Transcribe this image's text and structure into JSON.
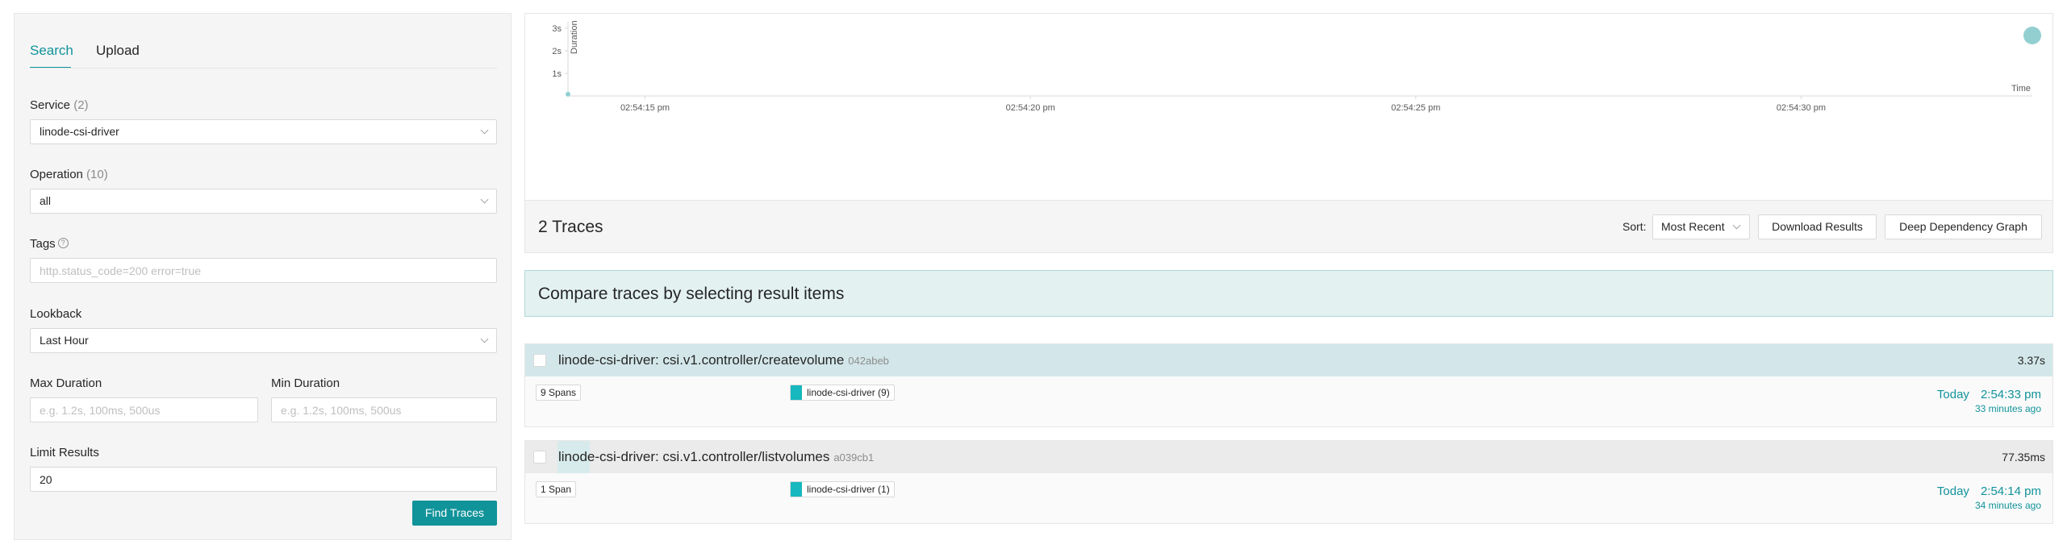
{
  "search_panel": {
    "tabs": [
      {
        "label": "Search",
        "active": true
      },
      {
        "label": "Upload",
        "active": false
      }
    ],
    "service": {
      "label": "Service",
      "count": "(2)",
      "value": "linode-csi-driver"
    },
    "operation": {
      "label": "Operation",
      "count": "(10)",
      "value": "all"
    },
    "tags": {
      "label": "Tags",
      "help_icon": "question-circle-icon",
      "value": "",
      "placeholder": "http.status_code=200 error=true"
    },
    "lookback": {
      "label": "Lookback",
      "value": "Last Hour"
    },
    "max_duration": {
      "label": "Max Duration",
      "value": "",
      "placeholder": "e.g. 1.2s, 100ms, 500us"
    },
    "min_duration": {
      "label": "Min Duration",
      "value": "",
      "placeholder": "e.g. 1.2s, 100ms, 500us"
    },
    "limit_results": {
      "label": "Limit Results",
      "value": "20"
    },
    "find_button": "Find Traces"
  },
  "chart_data": {
    "type": "scatter",
    "title": "",
    "xlabel": "Time",
    "ylabel": "Duration",
    "y_ticks": [
      "1s",
      "2s",
      "3s"
    ],
    "ylim": [
      0,
      3.37
    ],
    "x_ticks": [
      "02:54:15 pm",
      "02:54:20 pm",
      "02:54:25 pm",
      "02:54:30 pm"
    ],
    "x_tick_seconds": [
      15,
      20,
      25,
      30
    ],
    "xlim_seconds": [
      14,
      33
    ],
    "grid": false,
    "points": [
      {
        "time": "02:54:14 pm",
        "seconds": 14,
        "duration_s": 0.07735
      },
      {
        "time": "02:54:33 pm",
        "seconds": 33,
        "duration_s": 3.37
      }
    ],
    "point_color": "#93cfd1"
  },
  "results": {
    "count_label": "2 Traces",
    "sort_label": "Sort:",
    "sort_value": "Most Recent",
    "download_button": "Download Results",
    "dependency_button": "Deep Dependency Graph",
    "compare_banner": "Compare traces by selecting result items",
    "traces": [
      {
        "name": "linode-csi-driver: csi.v1.controller/createvolume",
        "id": "042abeb",
        "duration": "3.37s",
        "spans": "9 Spans",
        "service_tag": "linode-csi-driver (9)",
        "service_color": "#17b8be",
        "date": "Today",
        "time": "2:54:33 pm",
        "ago": "33 minutes ago"
      },
      {
        "name": "linode-csi-driver: csi.v1.controller/listvolumes",
        "id": "a039cb1",
        "duration": "77.35ms",
        "spans": "1 Span",
        "service_tag": "linode-csi-driver (1)",
        "service_color": "#17b8be",
        "date": "Today",
        "time": "2:54:14 pm",
        "ago": "34 minutes ago"
      }
    ]
  },
  "colors": {
    "accent": "#11939a",
    "highlight_bg": "#e3f1f1",
    "panel_bg": "#f5f5f5"
  }
}
